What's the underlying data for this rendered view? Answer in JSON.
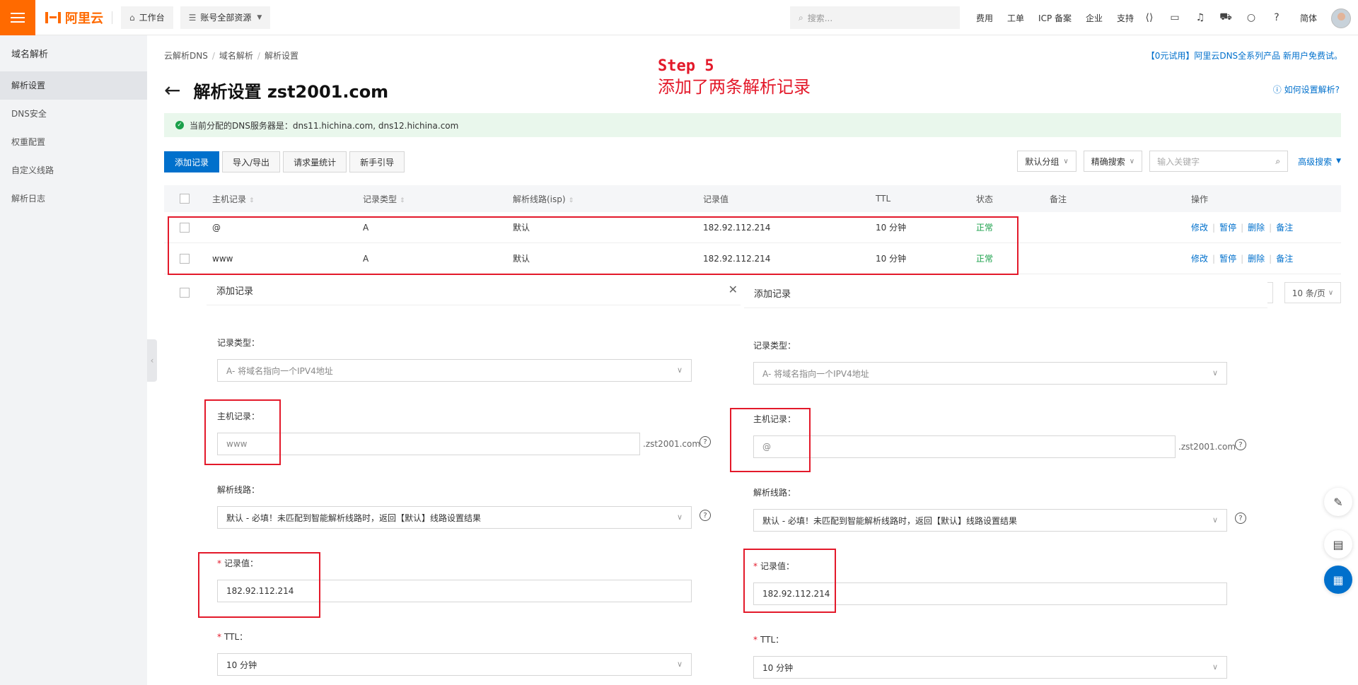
{
  "topbar": {
    "logo": "阿里云",
    "workbench": "工作台",
    "resources": "账号全部资源",
    "search_placeholder": "搜索...",
    "links": [
      "费用",
      "工单",
      "ICP 备案",
      "企业",
      "支持"
    ],
    "lang": "简体",
    "icons": [
      "code-icon",
      "terminal-icon",
      "bell-icon",
      "cart-icon",
      "bulb-icon",
      "help-icon"
    ]
  },
  "sidebar": {
    "title": "域名解析",
    "items": [
      "解析设置",
      "DNS安全",
      "权重配置",
      "自定义线路",
      "解析日志"
    ]
  },
  "breadcrumb": [
    "云解析DNS",
    "域名解析",
    "解析设置"
  ],
  "promo": "【0元试用】阿里云DNS全系列产品 新用户免费试。",
  "title": "解析设置 zst2001.com",
  "howto": "如何设置解析?",
  "annotation": {
    "step": "Step 5",
    "desc": "添加了两条解析记录"
  },
  "notice": "当前分配的DNS服务器是：dns11.hichina.com, dns12.hichina.com",
  "toolbar": {
    "add": "添加记录",
    "import_export": "导入/导出",
    "stats": "请求量统计",
    "guide": "新手引导",
    "group": "默认分组",
    "search_mode": "精确搜索",
    "keyword_placeholder": "输入关键字",
    "advanced": "高级搜索"
  },
  "table": {
    "headers": [
      "主机记录",
      "记录类型",
      "解析线路(isp)",
      "记录值",
      "TTL",
      "状态",
      "备注",
      "操作"
    ],
    "rows": [
      {
        "host": "@",
        "type": "A",
        "line": "默认",
        "value": "182.92.112.214",
        "ttl": "10 分钟",
        "status": "正常"
      },
      {
        "host": "www",
        "type": "A",
        "line": "默认",
        "value": "182.92.112.214",
        "ttl": "10 分钟",
        "status": "正常"
      }
    ],
    "ops": [
      "修改",
      "暂停",
      "删除",
      "备注"
    ]
  },
  "pager": {
    "size": "10 条/页"
  },
  "dialog_left": {
    "title": "添加记录",
    "type_label": "记录类型：",
    "type_value": "A- 将域名指向一个IPV4地址",
    "host_label": "主机记录：",
    "host_value": "www",
    "suffix": ".zst2001.com",
    "line_label": "解析线路：",
    "line_value": "默认 - 必填！未匹配到智能解析线路时，返回【默认】线路设置结果",
    "value_label": "记录值：",
    "value_value": "182.92.112.214",
    "ttl_label": "TTL：",
    "ttl_value": "10 分钟"
  },
  "dialog_right": {
    "title": "添加记录",
    "type_label": "记录类型：",
    "type_value": "A- 将域名指向一个IPV4地址",
    "host_label": "主机记录：",
    "host_value": "@",
    "suffix": ".zst2001.com",
    "line_label": "解析线路：",
    "line_value": "默认 - 必填！未匹配到智能解析线路时，返回【默认】线路设置结果",
    "value_label": "记录值：",
    "value_value": "182.92.112.214",
    "ttl_label": "TTL：",
    "ttl_value": "10 分钟"
  },
  "colors": {
    "accent": "#0070cc",
    "brand": "#ff6a00",
    "annotation": "#e3192a",
    "ok": "#1aa04a"
  }
}
